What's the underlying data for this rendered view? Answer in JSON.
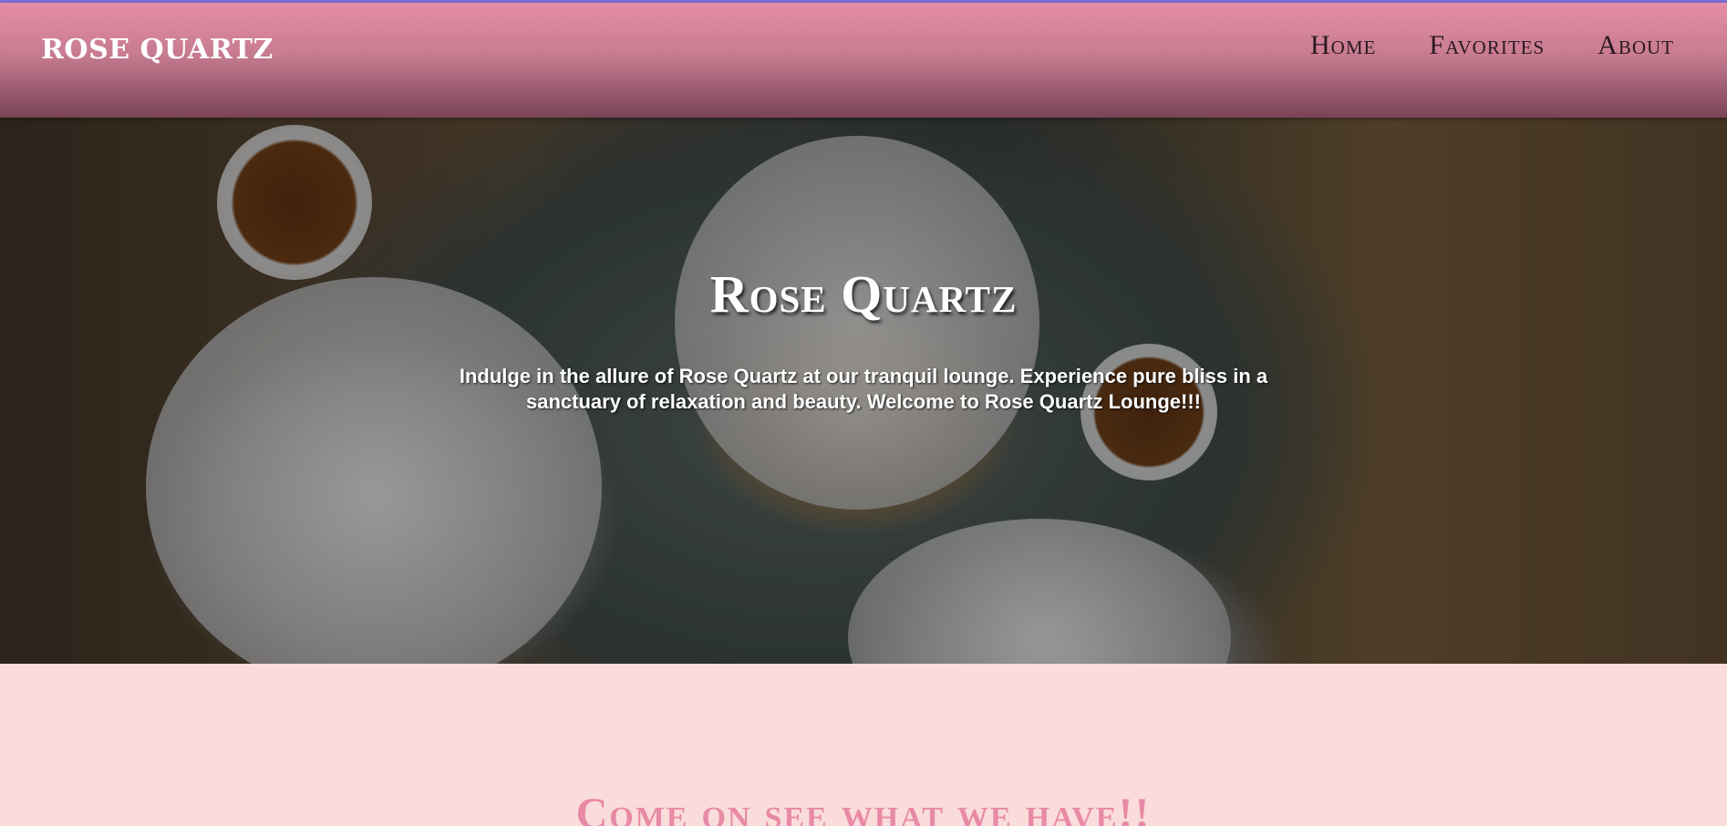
{
  "navbar": {
    "brand": "ROSE QUARTZ",
    "links": [
      "Home",
      "Favorites",
      "About"
    ]
  },
  "hero": {
    "title": "Rose Quartz",
    "text": "Indulge in the allure of Rose Quartz at our tranquil lounge. Experience pure bliss in a sanctuary of relaxation and beauty. Welcome to Rose Quartz Lounge!!!"
  },
  "section": {
    "heading": "Come on see what we have!!"
  },
  "colors": {
    "navbar_top": "#e58ea6",
    "navbar_bottom": "#7a4456",
    "page_background": "#fadcdb",
    "accent_heading": "#e88aa5"
  }
}
